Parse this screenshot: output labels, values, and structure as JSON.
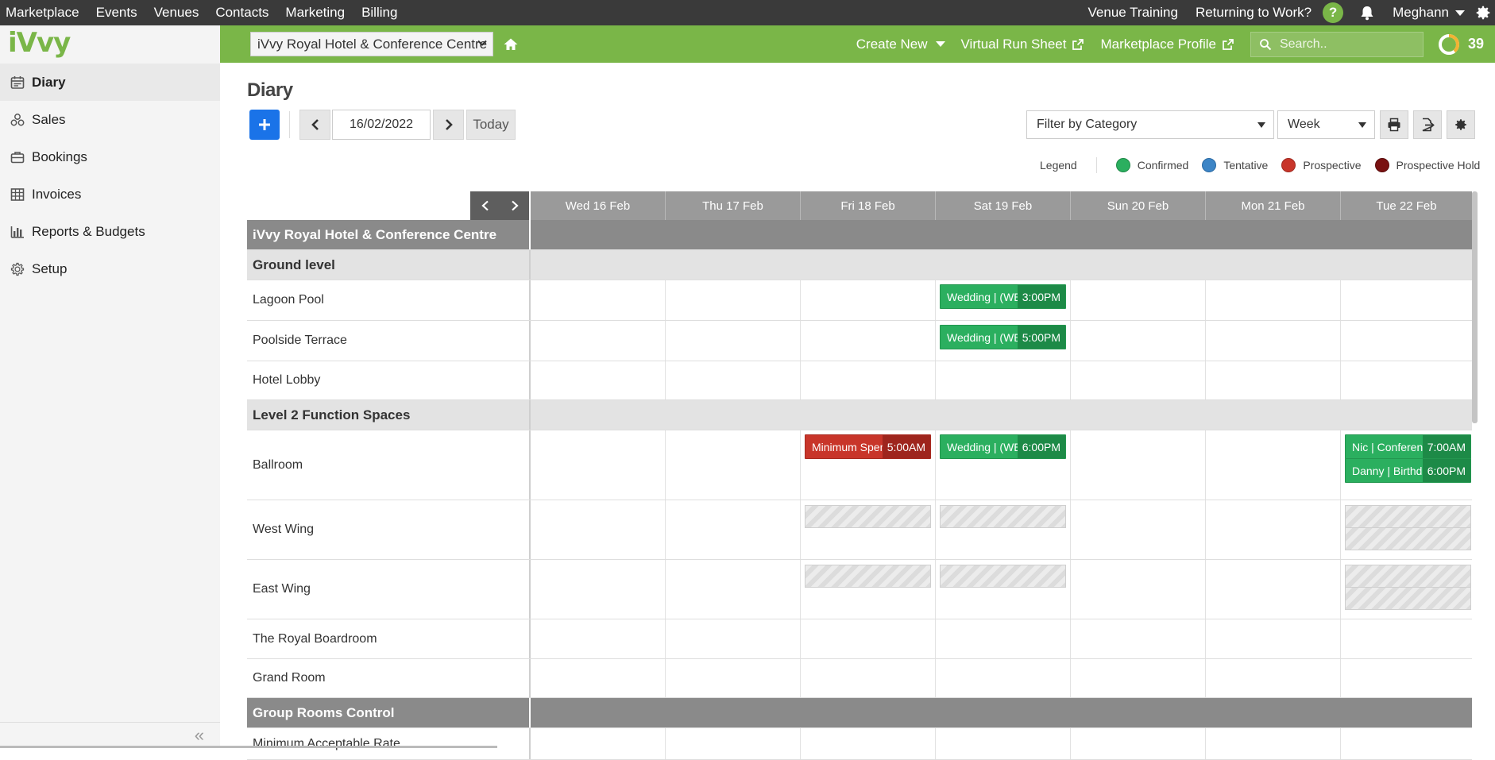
{
  "topnav": {
    "items": [
      "Marketplace",
      "Events",
      "Venues",
      "Contacts",
      "Marketing",
      "Billing"
    ],
    "right_links": [
      "Venue Training",
      "Returning to Work?"
    ],
    "help_symbol": "?",
    "user": "Meghann"
  },
  "brand": {
    "logo_text": "iVvy",
    "accent": "#7ab648"
  },
  "sidebar": {
    "items": [
      {
        "label": "Diary",
        "icon": "calendar-icon",
        "active": true
      },
      {
        "label": "Sales",
        "icon": "funnel-icon"
      },
      {
        "label": "Bookings",
        "icon": "briefcase-icon"
      },
      {
        "label": "Invoices",
        "icon": "table-icon"
      },
      {
        "label": "Reports & Budgets",
        "icon": "bar-chart-icon"
      },
      {
        "label": "Setup",
        "icon": "gear-icon"
      }
    ],
    "collapse_symbol": "«"
  },
  "header": {
    "venue": "iVvy Royal Hotel & Conference Centre",
    "create_new": "Create New",
    "virtual_run_sheet": "Virtual Run Sheet",
    "marketplace_profile": "Marketplace Profile",
    "search_placeholder": "Search..",
    "score": "39"
  },
  "diary": {
    "title": "Diary",
    "date": "16/02/2022",
    "today_label": "Today",
    "filter_label": "Filter by Category",
    "view_label": "Week",
    "legend_title": "Legend",
    "legend": [
      {
        "label": "Confirmed",
        "color": "#2baf5f"
      },
      {
        "label": "Tentative",
        "color": "#3d85c6"
      },
      {
        "label": "Prospective",
        "color": "#c8352a"
      },
      {
        "label": "Prospective Hold",
        "color": "#7a1212"
      }
    ],
    "days": [
      "Wed 16 Feb",
      "Thu 17 Feb",
      "Fri 18 Feb",
      "Sat 19 Feb",
      "Sun 20 Feb",
      "Mon 21 Feb",
      "Tue 22 Feb"
    ],
    "rows": [
      {
        "type": "venue",
        "label": "iVvy Royal Hotel & Conference Centre"
      },
      {
        "type": "group",
        "label": "Ground level"
      },
      {
        "type": "space",
        "label": "Lagoon Pool",
        "events": [
          {
            "day": 3,
            "name": "Wedding | (WE",
            "time": "3:00PM",
            "status": "conf"
          }
        ]
      },
      {
        "type": "space",
        "label": "Poolside Terrace",
        "events": [
          {
            "day": 3,
            "name": "Wedding | (WE",
            "time": "5:00PM",
            "status": "conf"
          }
        ]
      },
      {
        "type": "space",
        "label": "Hotel Lobby"
      },
      {
        "type": "group",
        "label": "Level 2 Function Spaces"
      },
      {
        "type": "space",
        "label": "Ballroom",
        "events": [
          {
            "day": 2,
            "name": "Minimum Spen",
            "time": "5:00AM",
            "status": "prosp"
          },
          {
            "day": 3,
            "name": "Wedding | (WE",
            "time": "6:00PM",
            "status": "conf"
          },
          {
            "day": 6,
            "name": "Nic | Conferen",
            "time": "7:00AM",
            "status": "conf"
          },
          {
            "day": 6,
            "name": "Danny | Birthd",
            "time": "6:00PM",
            "status": "conf"
          }
        ]
      },
      {
        "type": "space",
        "label": "West Wing",
        "blocks": [
          2,
          3,
          6,
          6
        ]
      },
      {
        "type": "space",
        "label": "East Wing",
        "blocks": [
          2,
          3,
          6,
          6
        ]
      },
      {
        "type": "space",
        "label": "The Royal Boardroom"
      },
      {
        "type": "space",
        "label": "Grand Room"
      },
      {
        "type": "venue",
        "label": "Group Rooms Control"
      },
      {
        "type": "space",
        "label": "Minimum Acceptable Rate"
      }
    ]
  }
}
